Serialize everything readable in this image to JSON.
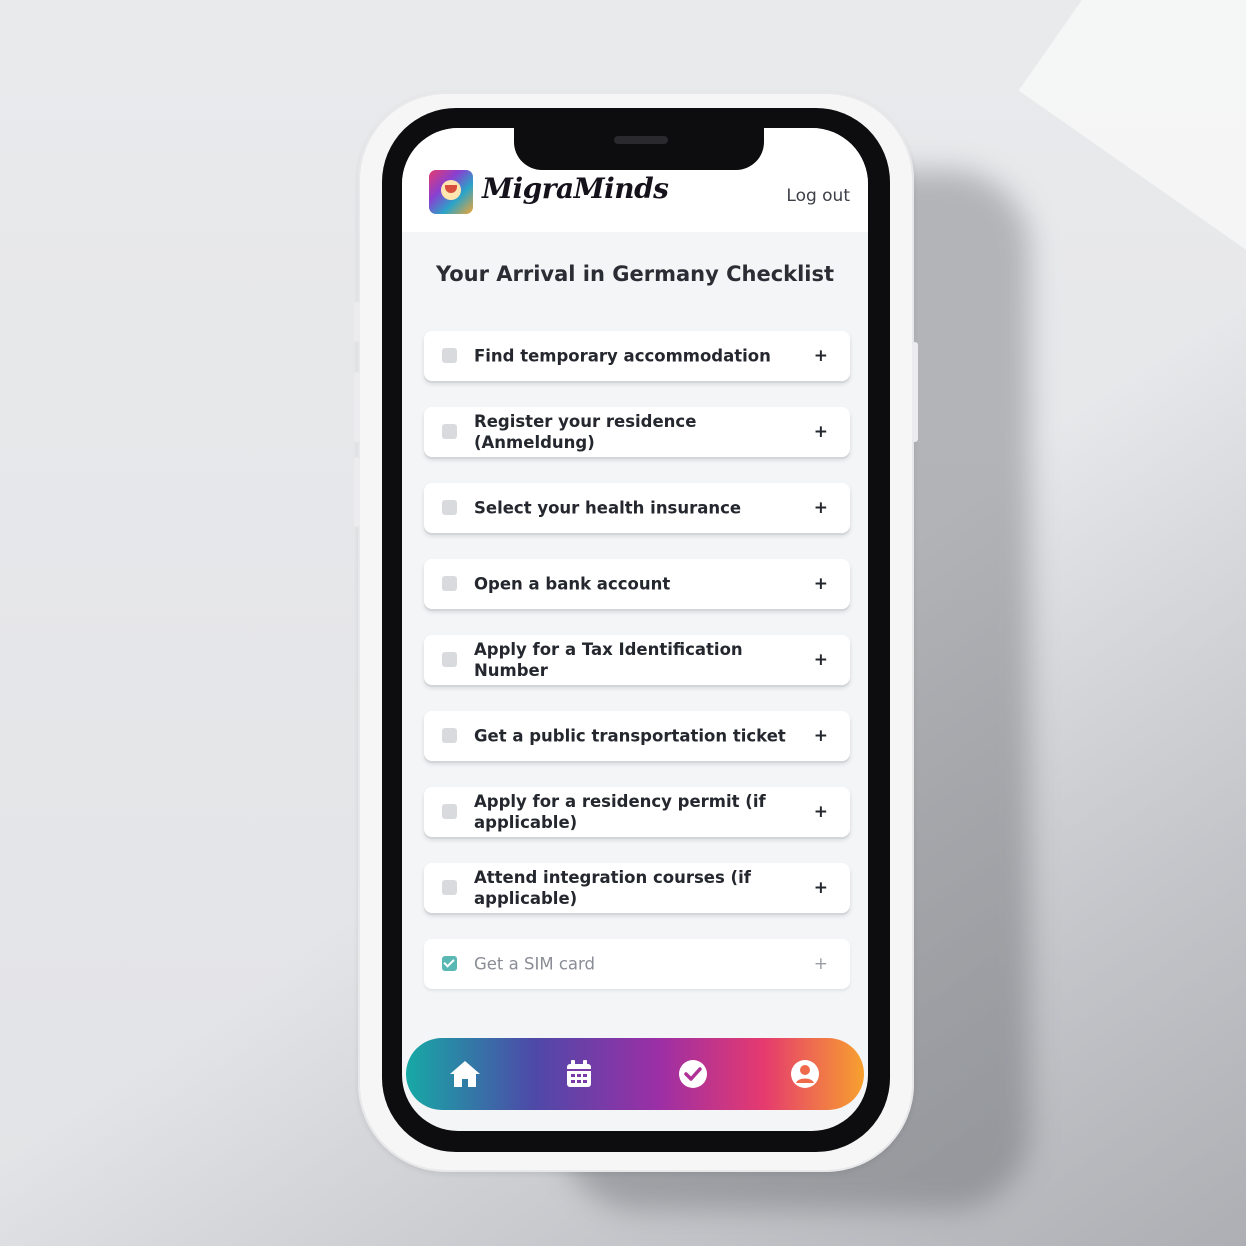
{
  "app": {
    "brand_name": "MigraMinds",
    "logout_label": "Log out"
  },
  "page": {
    "title": "Your Arrival in Germany Checklist"
  },
  "checklist": [
    {
      "label": "Find temporary accommodation",
      "checked": false,
      "expand": "+"
    },
    {
      "label": "Register your residence (Anmeldung)",
      "checked": false,
      "expand": "+"
    },
    {
      "label": "Select your health insurance",
      "checked": false,
      "expand": "+"
    },
    {
      "label": "Open a bank account",
      "checked": false,
      "expand": "+"
    },
    {
      "label": "Apply for a Tax Identification Number",
      "checked": false,
      "expand": "+"
    },
    {
      "label": "Get a public transportation ticket",
      "checked": false,
      "expand": "+"
    },
    {
      "label": "Apply for a residency permit (if applicable)",
      "checked": false,
      "expand": "+"
    },
    {
      "label": "Attend integration courses (if applicable)",
      "checked": false,
      "expand": "+"
    },
    {
      "label": "Get a SIM card",
      "checked": true,
      "expand": "+"
    }
  ],
  "bottom_nav": {
    "items": [
      {
        "icon": "home-icon"
      },
      {
        "icon": "calendar-icon"
      },
      {
        "icon": "check-circle-icon"
      },
      {
        "icon": "user-icon"
      }
    ]
  },
  "colors": {
    "accent_teal": "#17a9a5",
    "accent_purple": "#9b2fa6",
    "accent_pink": "#e53a6f",
    "accent_orange": "#f7a02e",
    "checked": "#5ab8b4"
  }
}
